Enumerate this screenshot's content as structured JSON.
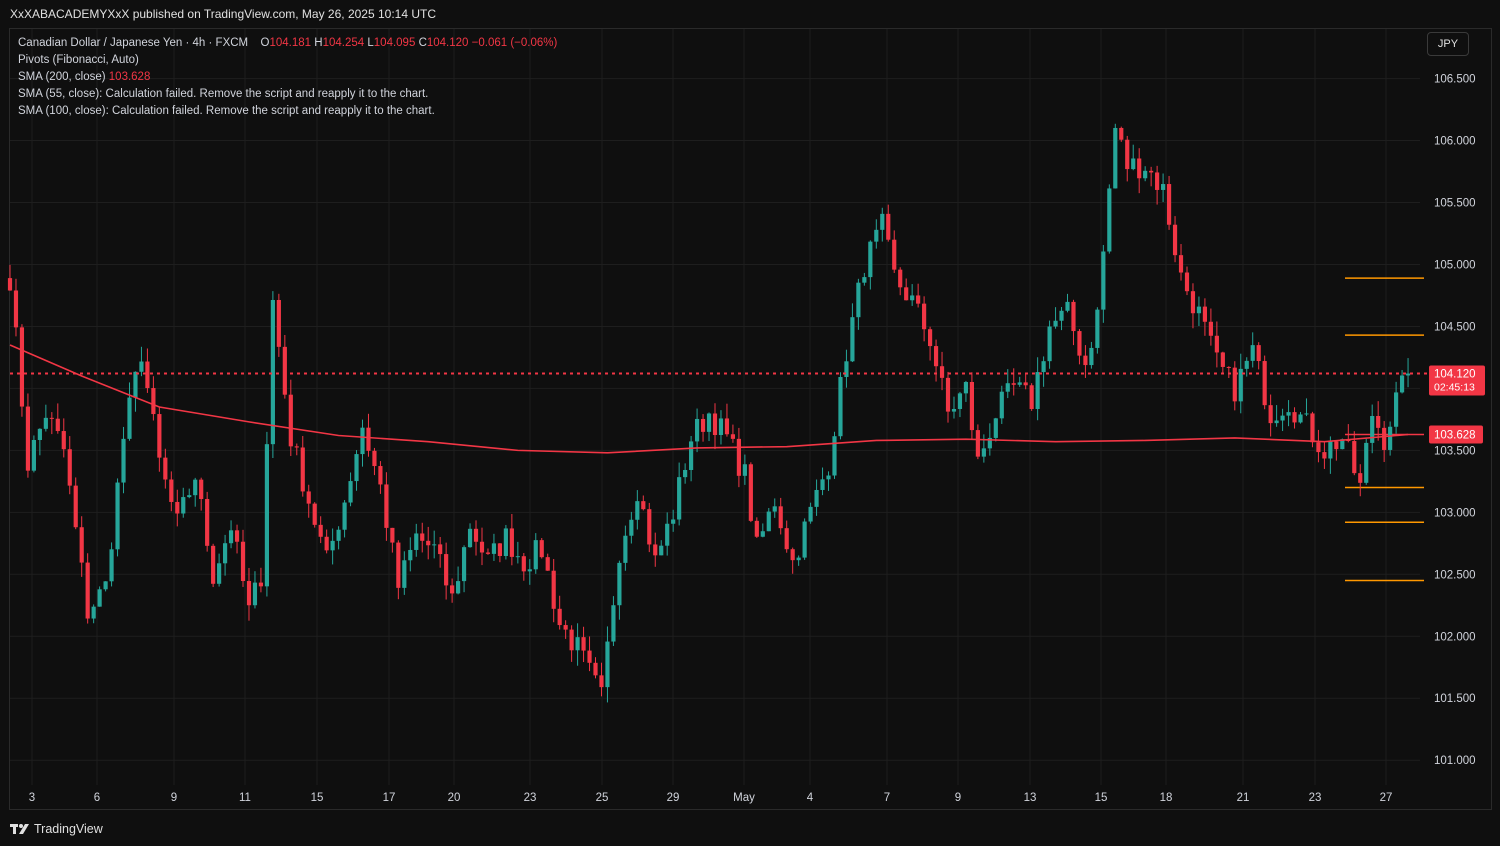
{
  "header": {
    "published": "XxXABACADEMYXxX published on TradingView.com, May 26, 2025 10:14 UTC"
  },
  "legend": {
    "symbol": "Canadian Dollar / Japanese Yen · 4h · FXCM",
    "o_label": "O",
    "o_value": "104.181",
    "h_label": "H",
    "h_value": "104.254",
    "l_label": "L",
    "l_value": "104.095",
    "c_label": "C",
    "c_value": "104.120",
    "change": "−0.061 (−0.06%)",
    "pivots": "Pivots (Fibonacci, Auto)",
    "sma200_label": "SMA (200, close)",
    "sma200_value": "103.628",
    "sma55": "SMA (55, close): Calculation failed. Remove the script and reapply it to the chart.",
    "sma100": "SMA (100, close): Calculation failed. Remove the script and reapply it to the chart."
  },
  "currency_button": "JPY",
  "footer": {
    "brand": "TradingView"
  },
  "colors": {
    "up": "#26a69a",
    "down": "#f23645",
    "sma": "#f23645",
    "pivot": "#ff9800",
    "grid": "#1e1e1e",
    "text": "#d1d4dc"
  },
  "chart_data": {
    "type": "candlestick",
    "timeframe": "4h",
    "x_ticks": [
      "3",
      "6",
      "9",
      "11",
      "15",
      "17",
      "20",
      "23",
      "25",
      "29",
      "May",
      "4",
      "7",
      "9",
      "13",
      "15",
      "18",
      "21",
      "23",
      "27"
    ],
    "y_ticks": [
      "101.000",
      "101.500",
      "102.000",
      "102.500",
      "103.000",
      "103.500",
      "104.000",
      "104.500",
      "105.000",
      "105.500",
      "106.000",
      "106.500"
    ],
    "ylim": [
      100.8,
      106.9
    ],
    "price_label": "104.120",
    "countdown": "02:45:13",
    "sma_label": "103.628",
    "current_price": 104.12,
    "sma200_current": 103.628,
    "pivot_levels": [
      104.89,
      104.43,
      103.2,
      102.92,
      102.45
    ],
    "anchors": [
      [
        0,
        104.9
      ],
      [
        3,
        103.4
      ],
      [
        6,
        103.8
      ],
      [
        9,
        103.5
      ],
      [
        13,
        102.2
      ],
      [
        16,
        102.4
      ],
      [
        19,
        103.6
      ],
      [
        22,
        104.3
      ],
      [
        25,
        103.4
      ],
      [
        28,
        102.9
      ],
      [
        31,
        103.3
      ],
      [
        34,
        102.5
      ],
      [
        37,
        102.9
      ],
      [
        40,
        102.2
      ],
      [
        42,
        102.5
      ],
      [
        44,
        104.7
      ],
      [
        47,
        103.6
      ],
      [
        50,
        103.1
      ],
      [
        53,
        102.6
      ],
      [
        56,
        103.1
      ],
      [
        59,
        103.7
      ],
      [
        62,
        103.2
      ],
      [
        65,
        102.4
      ],
      [
        68,
        102.8
      ],
      [
        71,
        102.7
      ],
      [
        74,
        102.3
      ],
      [
        77,
        102.9
      ],
      [
        80,
        102.6
      ],
      [
        83,
        102.8
      ],
      [
        86,
        102.6
      ],
      [
        89,
        102.7
      ],
      [
        92,
        102.1
      ],
      [
        95,
        101.9
      ],
      [
        97,
        101.7
      ],
      [
        99,
        101.5
      ],
      [
        102,
        102.7
      ],
      [
        105,
        103.2
      ],
      [
        108,
        102.6
      ],
      [
        111,
        103.0
      ],
      [
        114,
        103.6
      ],
      [
        117,
        103.8
      ],
      [
        120,
        103.6
      ],
      [
        123,
        103.3
      ],
      [
        125,
        102.7
      ],
      [
        128,
        103.1
      ],
      [
        131,
        102.6
      ],
      [
        134,
        103.0
      ],
      [
        137,
        103.4
      ],
      [
        140,
        104.3
      ],
      [
        143,
        105.0
      ],
      [
        146,
        105.3
      ],
      [
        148,
        104.9
      ],
      [
        151,
        104.7
      ],
      [
        154,
        104.4
      ],
      [
        157,
        103.8
      ],
      [
        160,
        104.0
      ],
      [
        162,
        103.4
      ],
      [
        165,
        103.8
      ],
      [
        168,
        104.0
      ],
      [
        171,
        103.9
      ],
      [
        174,
        104.5
      ],
      [
        177,
        104.6
      ],
      [
        180,
        104.2
      ],
      [
        182,
        104.6
      ],
      [
        185,
        106.1
      ],
      [
        187,
        105.8
      ],
      [
        190,
        105.8
      ],
      [
        193,
        105.6
      ],
      [
        196,
        104.9
      ],
      [
        199,
        104.6
      ],
      [
        202,
        104.2
      ],
      [
        205,
        104.0
      ],
      [
        208,
        104.3
      ],
      [
        211,
        103.8
      ],
      [
        214,
        103.9
      ],
      [
        217,
        103.7
      ],
      [
        220,
        103.5
      ],
      [
        223,
        103.6
      ],
      [
        226,
        103.2
      ],
      [
        228,
        103.8
      ],
      [
        230,
        103.6
      ],
      [
        232,
        103.9
      ],
      [
        234,
        104.1
      ]
    ],
    "sma200_path": [
      [
        0,
        104.35
      ],
      [
        12,
        104.1
      ],
      [
        25,
        103.85
      ],
      [
        40,
        103.73
      ],
      [
        55,
        103.62
      ],
      [
        70,
        103.57
      ],
      [
        85,
        103.5
      ],
      [
        100,
        103.48
      ],
      [
        115,
        103.52
      ],
      [
        130,
        103.53
      ],
      [
        145,
        103.58
      ],
      [
        160,
        103.59
      ],
      [
        175,
        103.57
      ],
      [
        190,
        103.58
      ],
      [
        205,
        103.6
      ],
      [
        220,
        103.57
      ],
      [
        234,
        103.628
      ]
    ],
    "x_domain": [
      0,
      236
    ]
  }
}
